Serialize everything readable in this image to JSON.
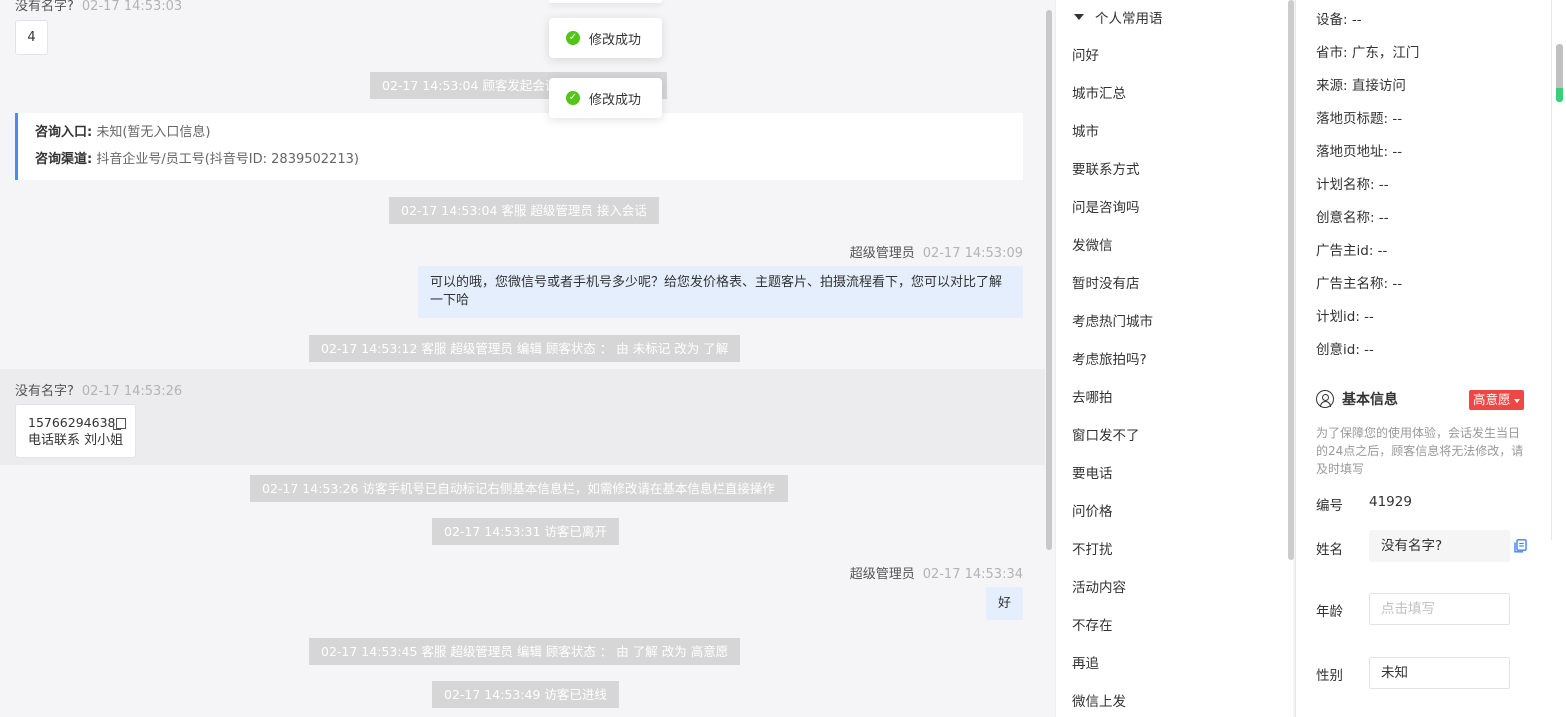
{
  "toasts": [
    "修改成功",
    "修改成功"
  ],
  "chat": {
    "top_sender": {
      "name": "没有名字?",
      "time": "02-17 14:53:03"
    },
    "top_bubble": "4",
    "sys1": "02-17 14:53:04 顾客发起会话",
    "entry_card": {
      "entry_label": "咨询入口:",
      "entry_value": "未知(暂无入口信息)",
      "channel_label": "咨询渠道:",
      "channel_value": "抖音企业号/员工号(抖音号ID: 2839502213)"
    },
    "sys2": "02-17 14:53:04 客服 超级管理员 接入会话",
    "agent_msg1": {
      "name": "超级管理员",
      "time": "02-17 14:53:09",
      "text": "可以的哦，您微信号或者手机号多少呢？给您发价格表、主题客片、拍摄流程看下，您可以对比了解一下哈"
    },
    "sys3": "02-17 14:53:12 客服 超级管理员 编辑 顾客状态 ： 由 未标记 改为 了解",
    "visitor_msg": {
      "name": "没有名字?",
      "time": "02-17 14:53:26",
      "line1": "15766294638",
      "line2": "电话联系 刘小姐"
    },
    "sys4": "02-17 14:53:26 访客手机号已自动标记右侧基本信息栏，如需修改请在基本信息栏直接操作",
    "sys5": "02-17 14:53:31 访客已离开",
    "agent_msg2": {
      "name": "超级管理员",
      "time": "02-17 14:53:34",
      "text": "好"
    },
    "sys6": "02-17 14:53:45 客服 超级管理员 编辑 顾客状态 ： 由 了解 改为 高意愿",
    "sys7": "02-17 14:53:49 访客已进线"
  },
  "phrases": {
    "header": "个人常用语",
    "items": [
      "问好",
      "城市汇总",
      "城市",
      "要联系方式",
      "问是咨询吗",
      "发微信",
      "暂时没有店",
      "考虑热门城市",
      "考虑旅拍吗?",
      "去哪拍",
      "窗口发不了",
      "要电话",
      "问价格",
      "不打扰",
      "活动内容",
      "不存在",
      "再追",
      "微信上发"
    ]
  },
  "info": {
    "attrs": [
      "设备: --",
      "省市: 广东，江门",
      "来源: 直接访问",
      "落地页标题: --",
      "落地页地址: --",
      "计划名称: --",
      "创意名称: --",
      "广告主id: --",
      "广告主名称: --",
      "计划id: --",
      "创意id: --"
    ],
    "basic_title": "基本信息",
    "intent_badge": "高意愿",
    "notice": "为了保障您的使用体验，会话发生当日的24点之后，顾客信息将无法修改，请及时填写",
    "id_label": "编号",
    "id_value": "41929",
    "name_label": "姓名",
    "name_value": "没有名字?",
    "age_label": "年龄",
    "age_placeholder": "点击填写",
    "gender_label": "性别",
    "gender_value": "未知"
  }
}
